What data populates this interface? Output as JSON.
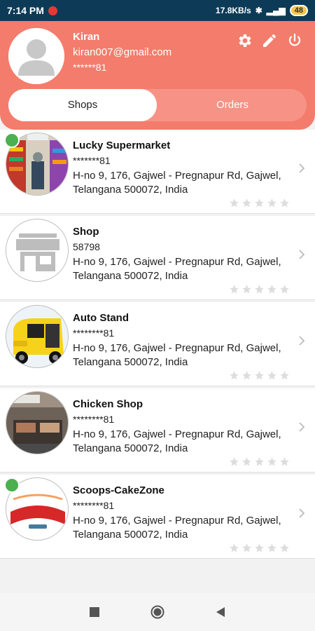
{
  "status": {
    "time": "7:14 PM",
    "network_speed": "17.8KB/s",
    "battery": "48"
  },
  "profile": {
    "name": "Kiran",
    "email": "kiran007@gmail.com",
    "phone": "******81"
  },
  "header_icons": [
    "gear-icon",
    "pencil-icon",
    "power-icon"
  ],
  "tabs": {
    "shops": "Shops",
    "orders": "Orders",
    "active": "Shops"
  },
  "shops": [
    {
      "title": "Lucky Supermarket",
      "code": "*******81",
      "address": "H-no 9, 176, Gajwel - Pregnapur Rd, Gajwel, Telangana 500072, India",
      "rating": 0,
      "online": true,
      "image": "supermarket"
    },
    {
      "title": "Shop",
      "code": "58798",
      "address": "H-no 9, 176, Gajwel - Pregnapur Rd, Gajwel, Telangana 500072, India",
      "rating": 0,
      "online": false,
      "image": "shop-placeholder"
    },
    {
      "title": "Auto Stand",
      "code": "********81",
      "address": "H-no 9, 176, Gajwel - Pregnapur Rd, Gajwel, Telangana 500072, India",
      "rating": 0,
      "online": false,
      "image": "auto-rickshaw"
    },
    {
      "title": "Chicken Shop",
      "code": "********81",
      "address": "H-no 9, 176, Gajwel - Pregnapur Rd, Gajwel, Telangana 500072, India",
      "rating": 0,
      "online": false,
      "image": "chicken-shop"
    },
    {
      "title": "Scoops-CakeZone",
      "code": "********81",
      "address": "H-no 9, 176, Gajwel - Pregnapur Rd, Gajwel, Telangana 500072, India",
      "rating": 0,
      "online": true,
      "image": "scoops-logo"
    }
  ],
  "colors": {
    "status_bar": "#0d3b57",
    "header": "#f47c6c",
    "online": "#4caf50",
    "star_empty": "#dddddd"
  }
}
